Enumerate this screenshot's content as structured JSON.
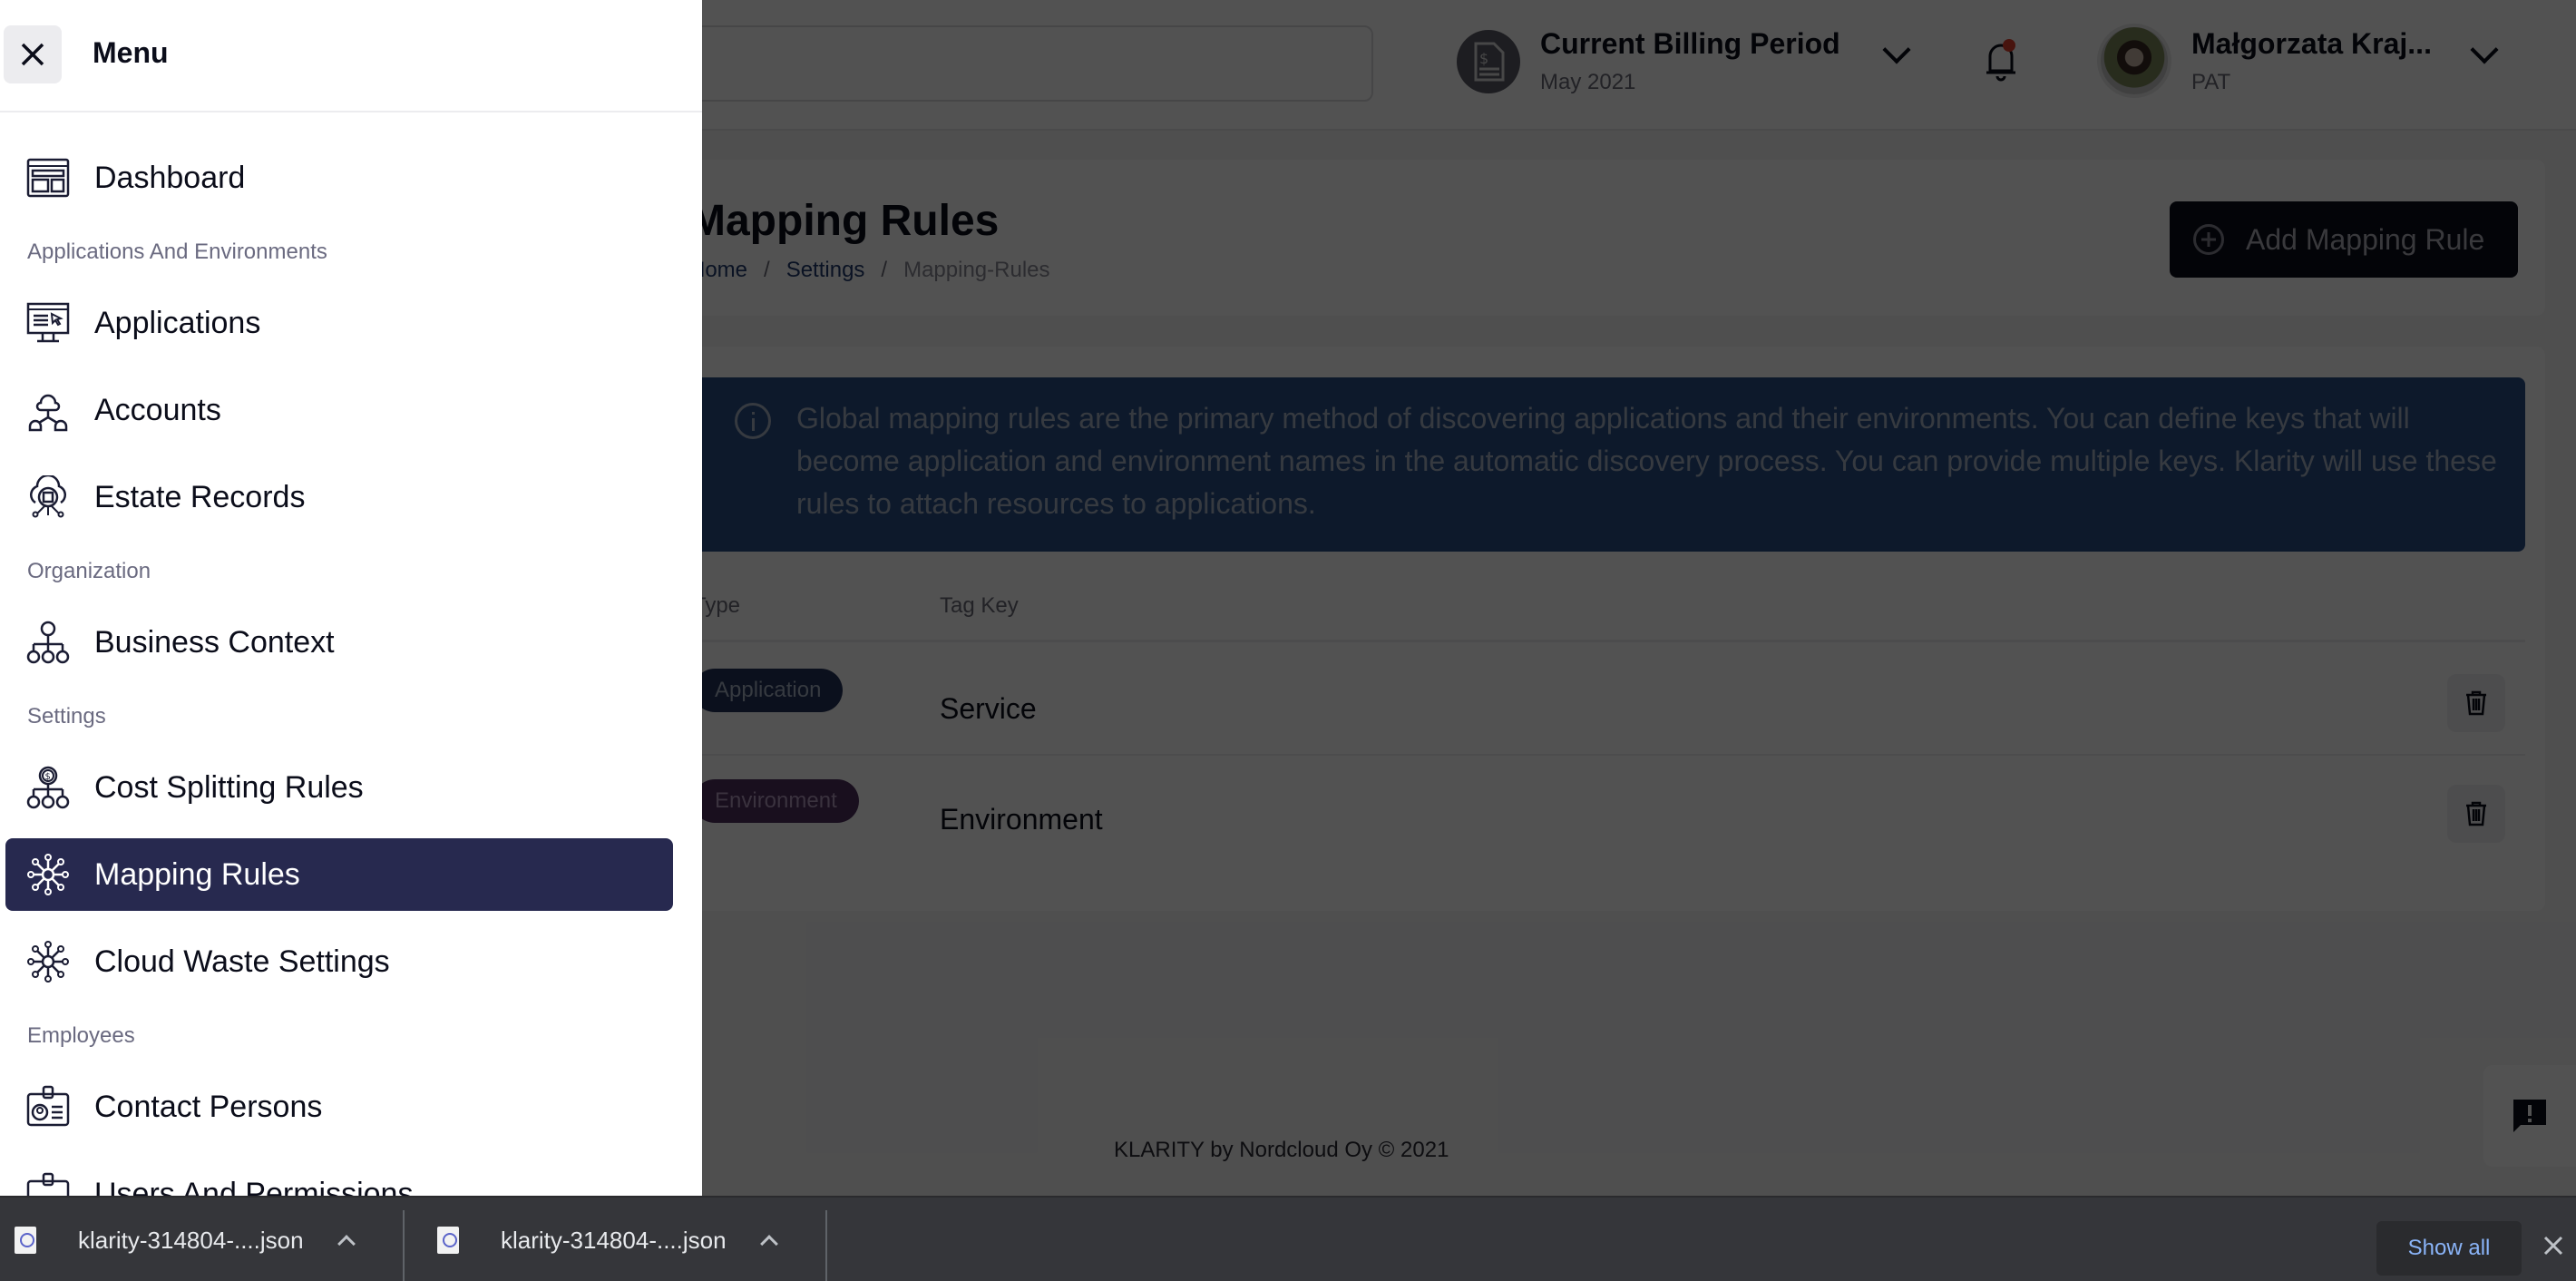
{
  "drawer": {
    "title": "Menu",
    "items": [
      {
        "type": "item",
        "label": "Dashboard",
        "icon": "dashboard-icon",
        "active": false
      },
      {
        "type": "section",
        "label": "Applications And Environments"
      },
      {
        "type": "item",
        "label": "Applications",
        "icon": "applications-icon",
        "active": false
      },
      {
        "type": "item",
        "label": "Accounts",
        "icon": "accounts-cloud-icon",
        "active": false
      },
      {
        "type": "item",
        "label": "Estate Records",
        "icon": "estate-records-icon",
        "active": false
      },
      {
        "type": "section",
        "label": "Organization"
      },
      {
        "type": "item",
        "label": "Business Context",
        "icon": "business-context-icon",
        "active": false
      },
      {
        "type": "section",
        "label": "Settings"
      },
      {
        "type": "item",
        "label": "Cost Splitting Rules",
        "icon": "cost-splitting-icon",
        "active": false
      },
      {
        "type": "item",
        "label": "Mapping Rules",
        "icon": "mapping-rules-icon",
        "active": true
      },
      {
        "type": "item",
        "label": "Cloud Waste Settings",
        "icon": "cloud-waste-icon",
        "active": false
      },
      {
        "type": "section",
        "label": "Employees"
      },
      {
        "type": "item",
        "label": "Contact Persons",
        "icon": "contact-persons-icon",
        "active": false
      },
      {
        "type": "item",
        "label": "Users And Permissions",
        "icon": "users-permissions-icon",
        "active": false
      }
    ]
  },
  "header": {
    "search_placeholder": "",
    "billing": {
      "title": "Current Billing Period",
      "period": "May 2021"
    },
    "notifications": {
      "has_unread": true
    },
    "user": {
      "name": "Małgorzata Kraj...",
      "role": "PAT"
    }
  },
  "page": {
    "title": "Mapping Rules",
    "breadcrumb": [
      {
        "label": "Home",
        "visible_label": "ome",
        "link": true
      },
      {
        "label": "Settings",
        "link": true
      },
      {
        "label": "Mapping-Rules",
        "link": false
      }
    ],
    "add_button_label": "Add Mapping Rule",
    "info_text": "Global mapping rules are the primary method of discovering applications and their environments. You can define keys that will become application and environment names in the automatic discovery process. You can provide multiple keys. Klarity will use these rules to attach resources to applications.",
    "table": {
      "columns": [
        "Type",
        "Tag Key"
      ],
      "rows": [
        {
          "type": "Application",
          "tag_key": "Service"
        },
        {
          "type": "Environment",
          "tag_key": "Environment"
        }
      ]
    },
    "footer": "KLARITY by Nordcloud Oy © 2021"
  },
  "downloads": {
    "files": [
      "klarity-314804-....json",
      "klarity-314804-....json"
    ],
    "show_all_label": "Show all"
  },
  "colors": {
    "active_nav": "#27294f",
    "info_box": "#2a4f86",
    "badge_application": "#23325a",
    "badge_environment": "#4e2f5e",
    "show_all_link": "#8ab4f8"
  }
}
